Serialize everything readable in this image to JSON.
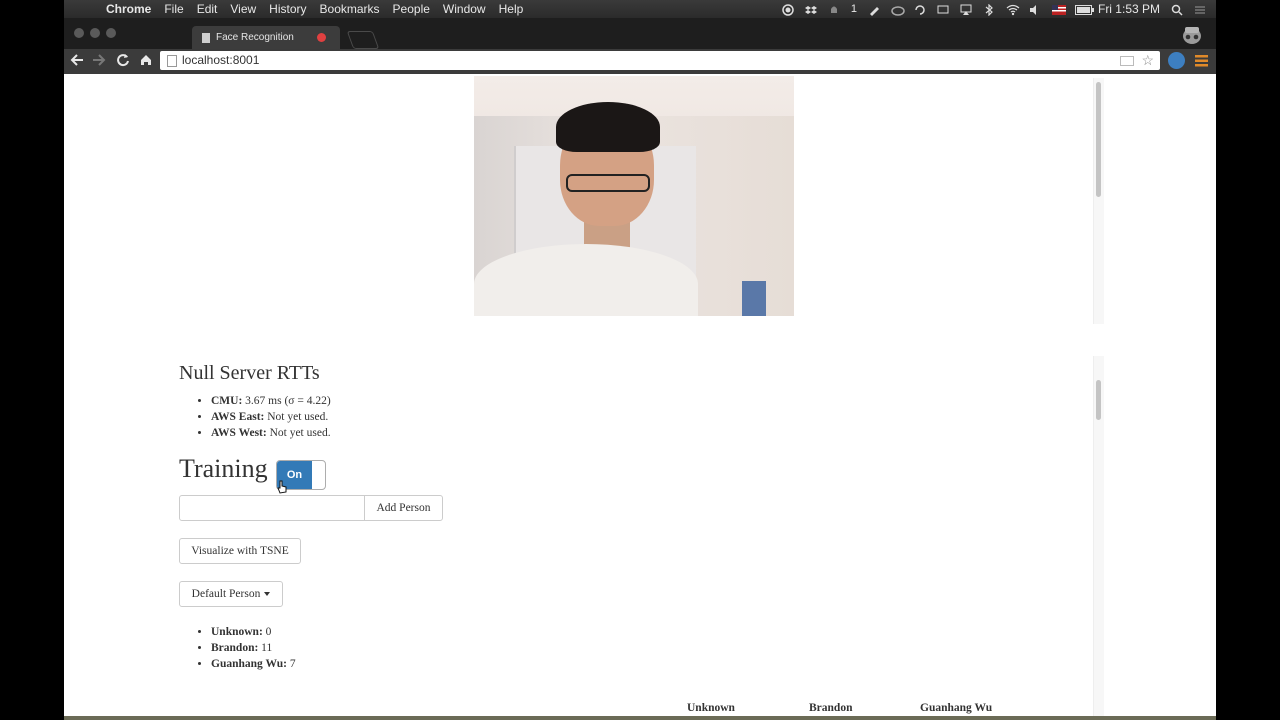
{
  "menubar": {
    "app_name": "Chrome",
    "menus": [
      "File",
      "Edit",
      "View",
      "History",
      "Bookmarks",
      "People",
      "Window",
      "Help"
    ],
    "notification_count": "1",
    "clock": "Fri 1:53 PM"
  },
  "browser": {
    "tab_title": "Face Recognition",
    "url": "localhost:8001"
  },
  "page": {
    "rtt_title": "Null Server RTTs",
    "rtt_items": [
      {
        "label": "CMU:",
        "value": "3.67 ms (σ = 4.22)"
      },
      {
        "label": "AWS East:",
        "value": "Not yet used."
      },
      {
        "label": "AWS West:",
        "value": "Not yet used."
      }
    ],
    "training_title": "Training",
    "training_toggle": "On",
    "person_input_placeholder": "",
    "add_person_label": "Add Person",
    "tsne_label": "Visualize with TSNE",
    "default_person_label": "Default Person",
    "person_counts": [
      {
        "label": "Unknown:",
        "value": "0"
      },
      {
        "label": "Brandon:",
        "value": "11"
      },
      {
        "label": "Guanhang Wu:",
        "value": "7"
      }
    ],
    "table_headers": [
      "Unknown",
      "Brandon",
      "Guanhang Wu"
    ]
  },
  "colors": {
    "toggle_on": "#337ab7",
    "tab_close": "#e04040"
  }
}
